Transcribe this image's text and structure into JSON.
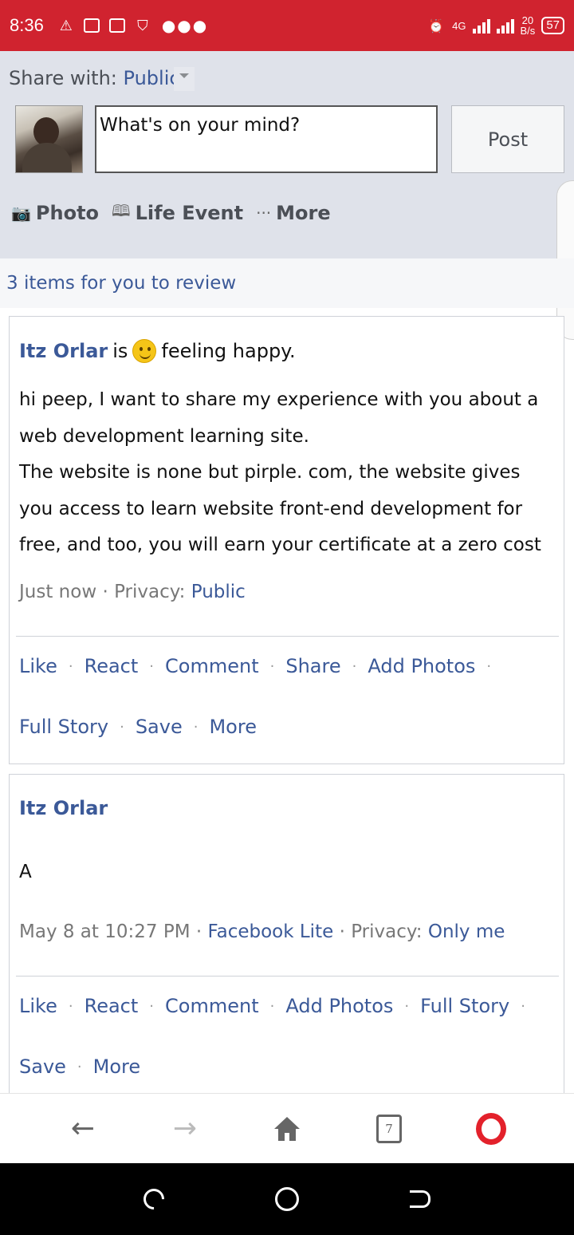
{
  "status_bar": {
    "time": "8:36",
    "network": "4G",
    "speed_value": "20",
    "speed_unit": "B/s",
    "battery": "57"
  },
  "composer": {
    "share_with_label": "Share with:",
    "share_with_value": "Public",
    "input_placeholder": "What's on your mind?",
    "post_label": "Post",
    "actions": {
      "photo": "Photo",
      "life_event": "Life Event",
      "more": "More"
    }
  },
  "review_banner": "3 items for you to review",
  "posts": [
    {
      "author": "Itz Orlar",
      "is_text": "is",
      "feeling": "feeling happy.",
      "body_lines": [
        "hi peep, I want to share my experience with you about a",
        "web development learning site.",
        "The website is none but pirple. com, the website gives",
        "you access to learn website front-end development for",
        "free, and too, you will earn your certificate at a zero cost"
      ],
      "time": "Just now",
      "privacy_label": "Privacy:",
      "privacy_value": "Public",
      "actions_row1": [
        "Like",
        "React",
        "Comment",
        "Share",
        "Add Photos"
      ],
      "actions_row2": [
        "Full Story",
        "Save",
        "More"
      ]
    },
    {
      "author": "Itz Orlar",
      "body": "A",
      "time": "May 8 at 10:27 PM",
      "via": "Facebook Lite",
      "privacy_label": "Privacy:",
      "privacy_value": "Only me",
      "actions_row1": [
        "Like",
        "React",
        "Comment",
        "Add Photos",
        "Full Story"
      ],
      "actions_row2": [
        "Save",
        "More"
      ]
    }
  ],
  "browser_nav": {
    "tab_count": "7"
  },
  "colors": {
    "status_bar": "#d0232f",
    "link": "#3b5998",
    "composer_bg": "#dfe2ea",
    "opera_red": "#e3212b"
  }
}
